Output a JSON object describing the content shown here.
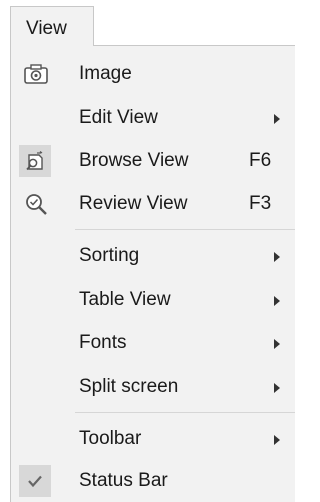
{
  "menu": {
    "title": "View",
    "items": [
      {
        "label": "Image",
        "icon": "camera-icon",
        "shortcut": "",
        "submenu": false
      },
      {
        "label": "Edit View",
        "icon": "",
        "shortcut": "",
        "submenu": true
      },
      {
        "label": "Browse View",
        "icon": "browse-icon",
        "shortcut": "F6",
        "submenu": false,
        "highlighted": true
      },
      {
        "label": "Review View",
        "icon": "magnifier-icon",
        "shortcut": "F3",
        "submenu": false
      },
      {
        "label": "Sorting",
        "icon": "",
        "shortcut": "",
        "submenu": true
      },
      {
        "label": "Table View",
        "icon": "",
        "shortcut": "",
        "submenu": true
      },
      {
        "label": "Fonts",
        "icon": "",
        "shortcut": "",
        "submenu": true
      },
      {
        "label": "Split screen",
        "icon": "",
        "shortcut": "",
        "submenu": true
      },
      {
        "label": "Toolbar",
        "icon": "",
        "shortcut": "",
        "submenu": true
      },
      {
        "label": "Status Bar",
        "icon": "checkmark-icon",
        "shortcut": "",
        "submenu": false,
        "checked": true
      }
    ]
  },
  "colors": {
    "menu_background": "#f2f2f2",
    "icon_highlight_background": "#d8d8d8",
    "text": "#1a1a1a",
    "separator": "#d6d6d6"
  }
}
